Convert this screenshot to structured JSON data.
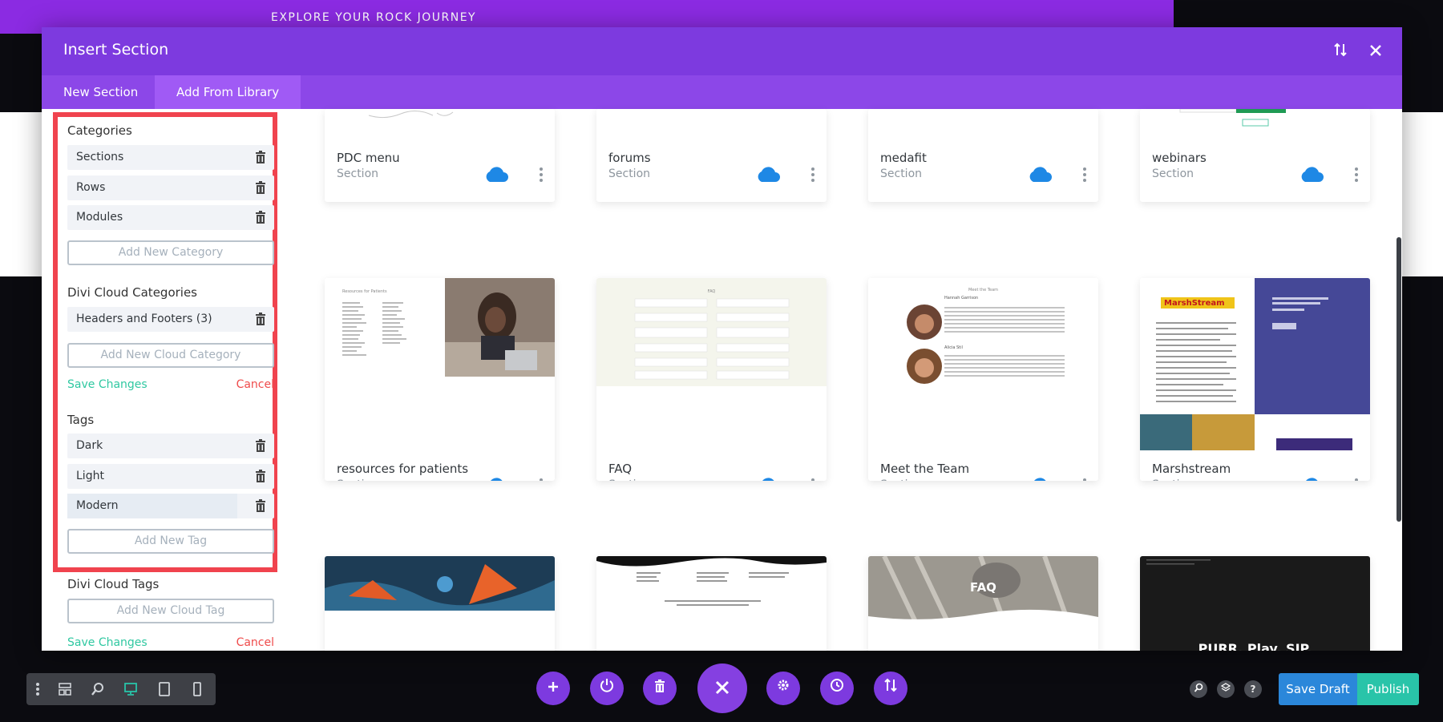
{
  "background": {
    "banner_text": "EXPLORE YOUR ROCK JOURNEY"
  },
  "modal": {
    "title": "Insert Section",
    "tabs": [
      {
        "label": "New Section",
        "active": false
      },
      {
        "label": "Add From Library",
        "active": true
      }
    ]
  },
  "sidebar": {
    "categories_title": "Categories",
    "categories": [
      {
        "label": "Sections"
      },
      {
        "label": "Rows"
      },
      {
        "label": "Modules"
      }
    ],
    "add_category": "Add New Category",
    "cloud_categories_title": "Divi Cloud Categories",
    "cloud_categories": [
      {
        "label": "Headers and Footers (3)"
      }
    ],
    "add_cloud_category": "Add New Cloud Category",
    "save_changes": "Save Changes",
    "cancel": "Cancel",
    "tags_title": "Tags",
    "tags": [
      {
        "label": "Dark"
      },
      {
        "label": "Light"
      },
      {
        "label": "Modern"
      }
    ],
    "add_tag": "Add New Tag",
    "cloud_tags_title": "Divi Cloud Tags",
    "add_cloud_tag": "Add New Cloud Tag",
    "save_changes_2": "Save Changes",
    "cancel_2": "Cancel"
  },
  "cards": [
    {
      "name": "PDC menu",
      "type": "Section"
    },
    {
      "name": "forums",
      "type": "Section"
    },
    {
      "name": "medafit",
      "type": "Section"
    },
    {
      "name": "webinars",
      "type": "Section"
    },
    {
      "name": "resources for patients",
      "type": "Section"
    },
    {
      "name": "FAQ",
      "type": "Section"
    },
    {
      "name": "Meet the Team",
      "type": "Section"
    },
    {
      "name": "Marshstream",
      "type": "Section"
    }
  ],
  "thumb_text": {
    "resources_heading": "Resources for Patients",
    "faq_heading": "FAQ",
    "team_heading": "Meet the Team",
    "team_member_1": "Hannah Garrison",
    "team_member_2": "Alicia Stil",
    "marsh_logo": "MarshStream",
    "faq_overlay": "FAQ",
    "purr_text": "PURR. Play. SIP."
  },
  "colors": {
    "header": "#7d3adf",
    "tabs": "#8c47e8",
    "highlight": "#f0434e",
    "save_link": "#2fc8a1",
    "cancel_link": "#ef4b4b",
    "cloud": "#1e88e5",
    "save_draft": "#2b87da",
    "publish": "#29c4a9"
  },
  "toolbar": {
    "save_draft": "Save Draft",
    "publish": "Publish",
    "left_icons": [
      "more-icon",
      "wireframe-icon",
      "zoom-icon",
      "desktop-icon",
      "tablet-icon",
      "phone-icon"
    ],
    "center_icons": [
      "add-icon",
      "power-icon",
      "trash-icon",
      "close-icon",
      "settings-icon",
      "history-icon",
      "sort-icon"
    ],
    "right_icons": [
      "search-icon",
      "layers-icon",
      "help-icon"
    ]
  }
}
